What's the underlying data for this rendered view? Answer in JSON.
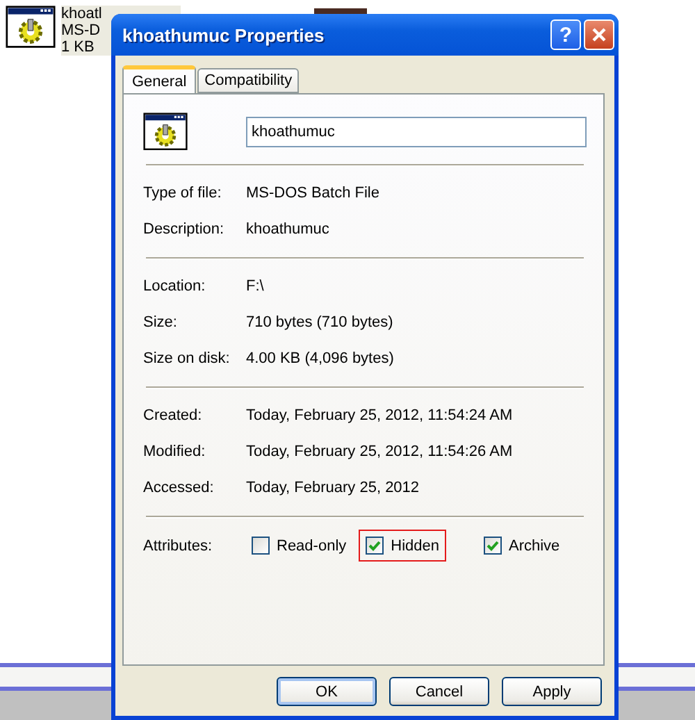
{
  "desktop": {
    "files": [
      {
        "lines": [
          "khoatl",
          "MS-D",
          "1 KB"
        ],
        "selected": true
      }
    ]
  },
  "window": {
    "title": "khoathumuc Properties",
    "help": "?"
  },
  "tabs": [
    {
      "label": "General",
      "selected": true
    },
    {
      "label": "Compatibility",
      "selected": false
    }
  ],
  "name_field": {
    "value": "khoathumuc"
  },
  "groups": [
    [
      {
        "label": "Type of file:",
        "value": "MS-DOS Batch File"
      },
      {
        "label": "Description:",
        "value": "khoathumuc"
      }
    ],
    [
      {
        "label": "Location:",
        "value": "F:\\"
      },
      {
        "label": "Size:",
        "value": "710 bytes (710 bytes)"
      },
      {
        "label": "Size on disk:",
        "value": "4.00 KB (4,096 bytes)"
      }
    ],
    [
      {
        "label": "Created:",
        "value": "Today, February 25, 2012, 11:54:24 AM"
      },
      {
        "label": "Modified:",
        "value": "Today, February 25, 2012, 11:54:26 AM"
      },
      {
        "label": "Accessed:",
        "value": "Today, February 25, 2012"
      }
    ]
  ],
  "attributes": {
    "label": "Attributes:",
    "items": [
      {
        "label": "Read-only",
        "checked": false,
        "highlighted": false
      },
      {
        "label": "Hidden",
        "checked": true,
        "highlighted": true
      },
      {
        "label": "Archive",
        "checked": true,
        "highlighted": false
      }
    ]
  },
  "buttons": [
    {
      "label": "OK",
      "default": true
    },
    {
      "label": "Cancel",
      "default": false
    },
    {
      "label": "Apply",
      "default": false
    }
  ]
}
